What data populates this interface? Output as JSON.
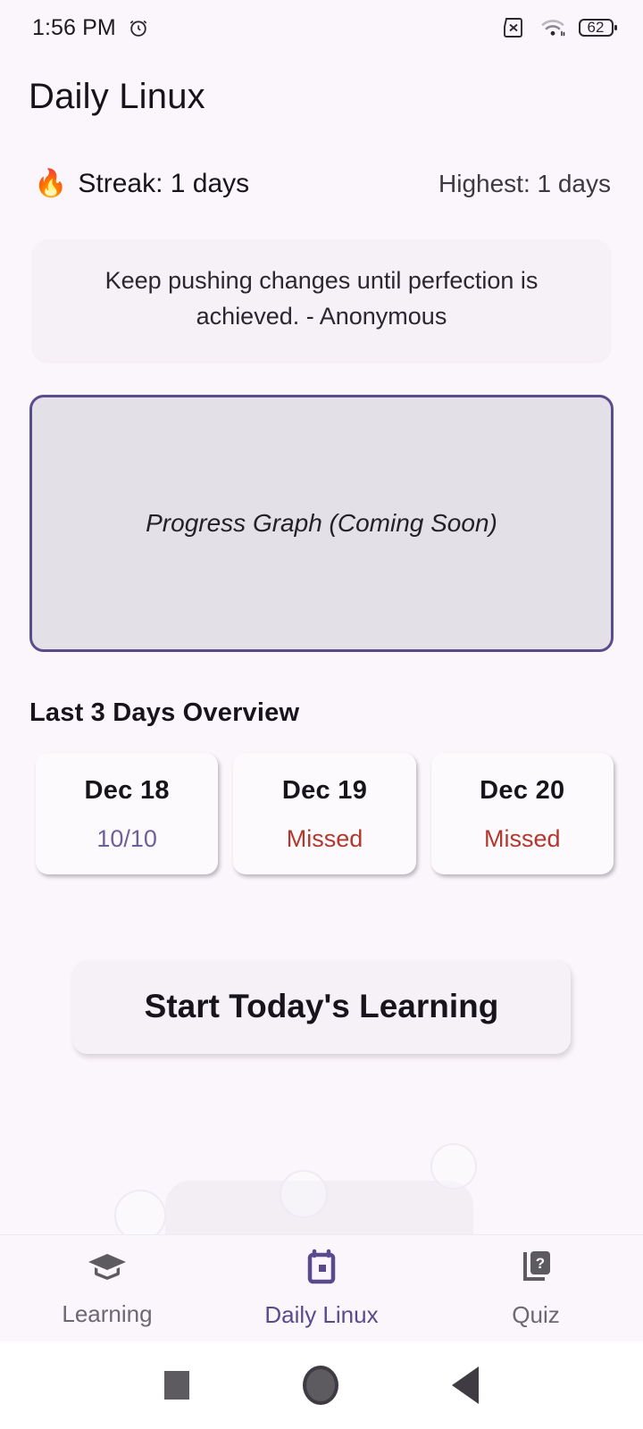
{
  "status_bar": {
    "time": "1:56 PM",
    "alarm_icon": "alarm-clock-icon",
    "sim_icon": "sim-card-off-icon",
    "wifi_icon": "wifi-icon",
    "battery_icon": "battery-icon",
    "battery_level": "62"
  },
  "header": {
    "title": "Daily Linux"
  },
  "streak": {
    "flame": "🔥",
    "current_label": "Streak: 1 days",
    "highest_label": "Highest: 1 days"
  },
  "quote": {
    "text": "Keep pushing changes until perfection is achieved. - Anonymous"
  },
  "progress_graph": {
    "placeholder_label": "Progress Graph (Coming Soon)",
    "border_color": "#5a4b8c",
    "fill_color": "#e4e0e8"
  },
  "overview": {
    "title": "Last 3 Days Overview",
    "days": [
      {
        "date": "Dec 18",
        "status": "10/10",
        "state": "done"
      },
      {
        "date": "Dec 19",
        "status": "Missed",
        "state": "missed"
      },
      {
        "date": "Dec 20",
        "status": "Missed",
        "state": "missed"
      }
    ]
  },
  "primary_action": {
    "label": "Start Today's Learning"
  },
  "bottom_nav": {
    "items": [
      {
        "label": "Learning",
        "icon": "graduation-cap-icon",
        "active": false
      },
      {
        "label": "Daily Linux",
        "icon": "calendar-icon",
        "active": true
      },
      {
        "label": "Quiz",
        "icon": "quiz-question-card-icon",
        "active": false
      }
    ],
    "active_color": "#584a8f",
    "inactive_color": "#6c6772"
  },
  "system_nav": {
    "recents": "square-recents-icon",
    "home": "circle-home-icon",
    "back": "triangle-back-icon"
  },
  "colors": {
    "page_background": "#fbf6fb",
    "accent_purple": "#584a8f",
    "missed_red": "#b2372d",
    "done_purple": "#6d5f99"
  }
}
